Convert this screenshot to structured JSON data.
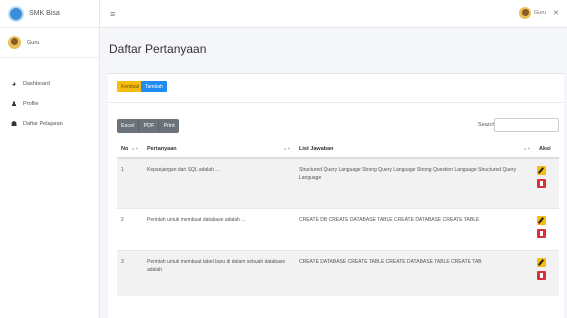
{
  "brand": {
    "name": "SMK Bisa"
  },
  "sidebar": {
    "user": "Guru",
    "items": [
      {
        "label": "Dashboard",
        "icon": "dashboard-icon"
      },
      {
        "label": "Profile",
        "icon": "user-icon"
      },
      {
        "label": "Daftar Pelajaran",
        "icon": "users-icon"
      }
    ]
  },
  "topbar": {
    "menu_icon": "≡",
    "user": "Guru",
    "close": "✕"
  },
  "page": {
    "title": "Daftar Pertanyaan"
  },
  "buttons": {
    "kembali": "Kembali",
    "tambah": "Tambah"
  },
  "export": {
    "excel": "Excel",
    "pdf": "PDF",
    "print": "Print"
  },
  "search": {
    "label": "Search:",
    "value": ""
  },
  "table": {
    "headers": {
      "no": "No",
      "pertanyaan": "Pertanyaan",
      "jawaban": "List Jawaban",
      "aksi": "Aksi"
    },
    "rows": [
      {
        "no": "1",
        "pertanyaan": "Kepanjangan dari SQL adalah ...",
        "jawaban": "Structured Query Language Strong Query Language Strong Question Language Structured Query Language"
      },
      {
        "no": "2",
        "pertanyaan": "Perintah untuk membuat database adalah ...",
        "jawaban": "CREATE DB CREATE DATABASE TABLE CREATE DATABASE CREATE TABLE"
      },
      {
        "no": "3",
        "pertanyaan": "Perintah untuk membuat tabel baru di dalam sebuah database adalah",
        "jawaban": "CREATE DATABASE CREATE TABLE CREATE DATABASE TABLE CREATE TAB"
      }
    ]
  },
  "colors": {
    "kembali": "#f5bd14",
    "tambah": "#1f8bf3",
    "edit": "#f5bd14",
    "delete": "#dc2f3c",
    "export": "#6b7279"
  }
}
